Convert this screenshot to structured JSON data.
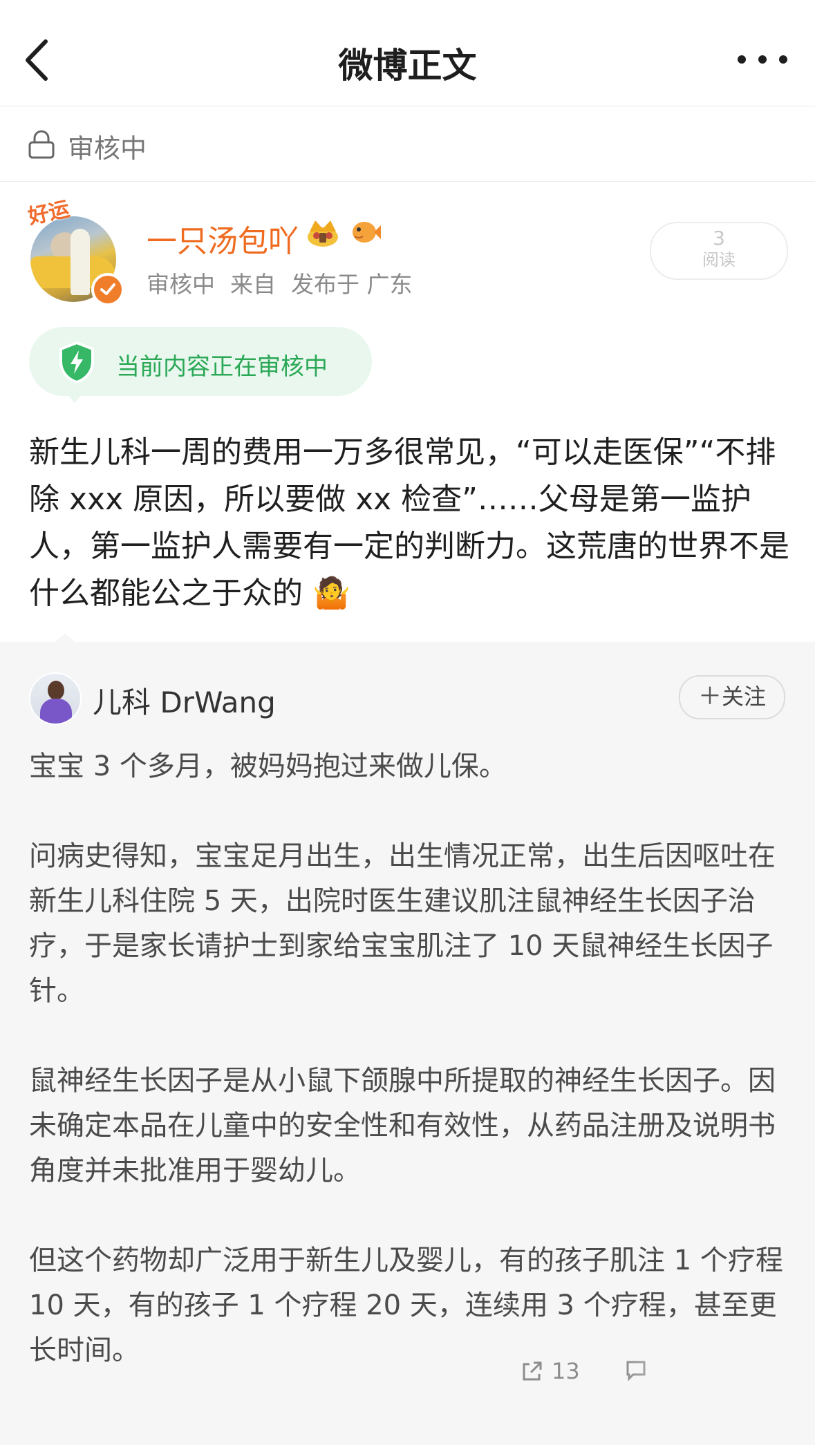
{
  "nav": {
    "title": "微博正文"
  },
  "review_bar": {
    "status": "审核中"
  },
  "post": {
    "username": "一只汤包吖",
    "avatar_badge": "好运",
    "meta": {
      "status": "审核中",
      "source": "来自",
      "location": "发布于 广东"
    },
    "reads": {
      "count": "3",
      "label": "阅读"
    },
    "audit_notice": "当前内容正在审核中",
    "text": "新生儿科一周的费用一万多很常见，“可以走医保”“不排除 xxx 原因，所以要做 xx 检查”……父母是第一监护人，第一监护人需要有一定的判断力。这荒唐的世界不是什么都能公之于众的",
    "emoji": "🤷"
  },
  "repost": {
    "username": "儿科 DrWang",
    "follow_label": "关注",
    "paragraphs": [
      "宝宝 3 个多月，被妈妈抱过来做儿保。",
      "问病史得知，宝宝足月出生，出生情况正常，出生后因呕吐在新生儿科住院 5 天，出院时医生建议肌注鼠神经生长因子治疗，于是家长请护士到家给宝宝肌注了 10 天鼠神经生长因子针。",
      "鼠神经生长因子是从小鼠下颌腺中所提取的神经生长因子。因未确定本品在儿童中的安全性和有效性，从药品注册及说明书角度并未批准用于婴幼儿。",
      "但这个药物却广泛用于新生儿及婴儿，有的孩子肌注 1 个疗程 10 天，有的孩子 1 个疗程 20 天，连续用 3 个疗程，甚至更长时间。"
    ],
    "share_count": "13"
  },
  "colors": {
    "accent_orange": "#ee6b1f",
    "audit_green": "#2aa856"
  },
  "icons": [
    "back-arrow-icon",
    "more-dots-icon",
    "lock-icon",
    "verified-icon",
    "crown-icon",
    "fish-icon",
    "shield-icon",
    "share-icon",
    "comment-icon"
  ]
}
